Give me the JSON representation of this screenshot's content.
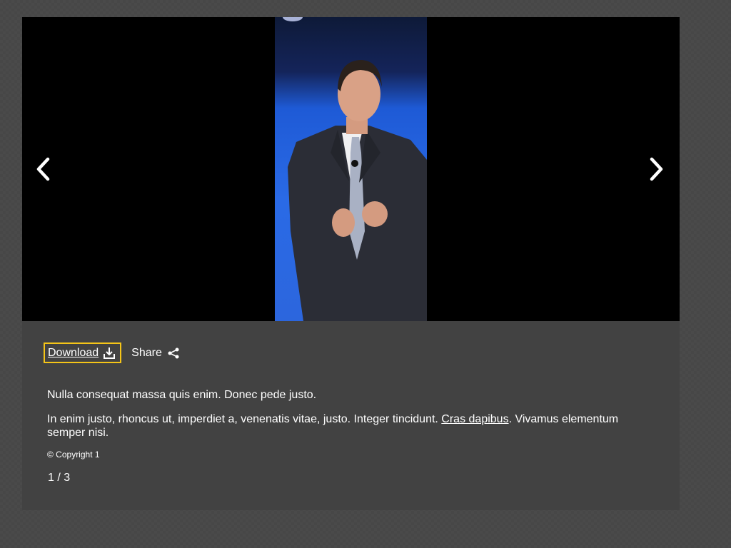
{
  "viewer": {
    "image_alt": "Man in a dark suit speaking on stage",
    "prev_icon": "chevron-left-icon",
    "next_icon": "chevron-right-icon"
  },
  "actions": {
    "download_label": "Download",
    "download_icon": "download-icon",
    "share_label": "Share",
    "share_icon": "share-icon",
    "focus_color": "#f5c518"
  },
  "caption": {
    "line1": "Nulla consequat massa quis enim. Donec pede justo.",
    "line2_before": "In enim justo, rhoncus ut, imperdiet a, venenatis vitae, justo. Integer tincidunt. ",
    "line2_link": "Cras dapibus",
    "line2_after": ". Vivamus elementum semper nisi.",
    "copyright": "© Copyright 1"
  },
  "pagination": {
    "counter": "1 / 3"
  }
}
